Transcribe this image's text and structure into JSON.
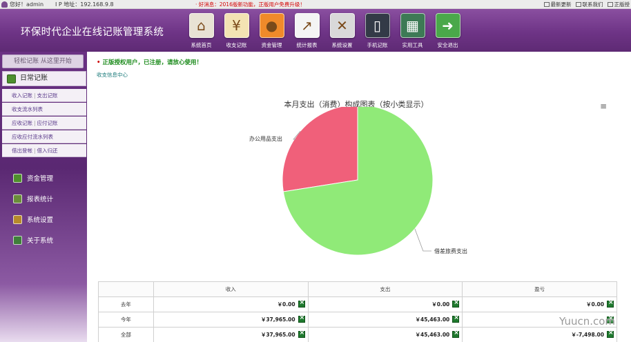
{
  "topbar": {
    "greeting": "您好！admin",
    "ip": "I P 地址：192.168.9.8",
    "marquee": "· 好消息：2016版新功能，正版用户免费升级！",
    "links": [
      "最新更新",
      "联系我们",
      "正版授"
    ]
  },
  "header": {
    "title": "环保时代企业在线记账管理系统",
    "nav": [
      {
        "label": "系统首页",
        "icon": "home-icon",
        "color": "#e8e2d4"
      },
      {
        "label": "收支记账",
        "icon": "yen-book-icon",
        "color": "#f3e3b3"
      },
      {
        "label": "资金管理",
        "icon": "piggy-bank-icon",
        "color": "#f08a2a"
      },
      {
        "label": "统计报表",
        "icon": "chart-icon",
        "color": "#f4f4f4"
      },
      {
        "label": "系统设置",
        "icon": "tools-icon",
        "color": "#d9d9d9"
      },
      {
        "label": "手机记账",
        "icon": "phone-icon",
        "color": "#333a47"
      },
      {
        "label": "实用工具",
        "icon": "calculator-icon",
        "color": "#3d7a55"
      },
      {
        "label": "安全退出",
        "icon": "exit-icon",
        "color": "#4aa84a"
      }
    ]
  },
  "sidebar": {
    "slogan": "轻松记账 从这里开始",
    "daily_label": "日常记账",
    "subitems": [
      [
        "收入记账",
        "支出记账"
      ],
      [
        "收支流水列表"
      ],
      [
        "应收记账",
        "应付记账"
      ],
      [
        "应收应付流水列表"
      ],
      [
        "借出登帐",
        "借入归还"
      ]
    ],
    "groups": [
      "资金管理",
      "报表统计",
      "系统设置",
      "关于系统"
    ],
    "group_colors": [
      "#4f8f2c",
      "#6a8d3a",
      "#b78a2a",
      "#3f7f3a"
    ]
  },
  "main": {
    "notice": "正版授权用户，已注册，请放心使用！",
    "center_link": "收支信息中心"
  },
  "chart_data": {
    "type": "pie",
    "title": "本月支出（消费）构成图表（按小类显示）",
    "slices": [
      {
        "name": "办公用品支出",
        "value": 27.5,
        "color": "#f0607a"
      },
      {
        "name": "借差旅费支出",
        "value": 72.5,
        "color": "#90ea78"
      }
    ]
  },
  "summary": {
    "headers": [
      "",
      "收入",
      "支出",
      "盈亏"
    ],
    "rows": [
      {
        "label": "去年",
        "income": "￥0.00",
        "expense": "￥0.00",
        "profit": "￥0.00"
      },
      {
        "label": "今年",
        "income": "￥37,965.00",
        "expense": "￥45,463.00",
        "profit": ""
      },
      {
        "label": "全部",
        "income": "￥37,965.00",
        "expense": "￥45,463.00",
        "profit": "￥-7,498.00"
      }
    ]
  },
  "watermark": "Yuucn.com"
}
